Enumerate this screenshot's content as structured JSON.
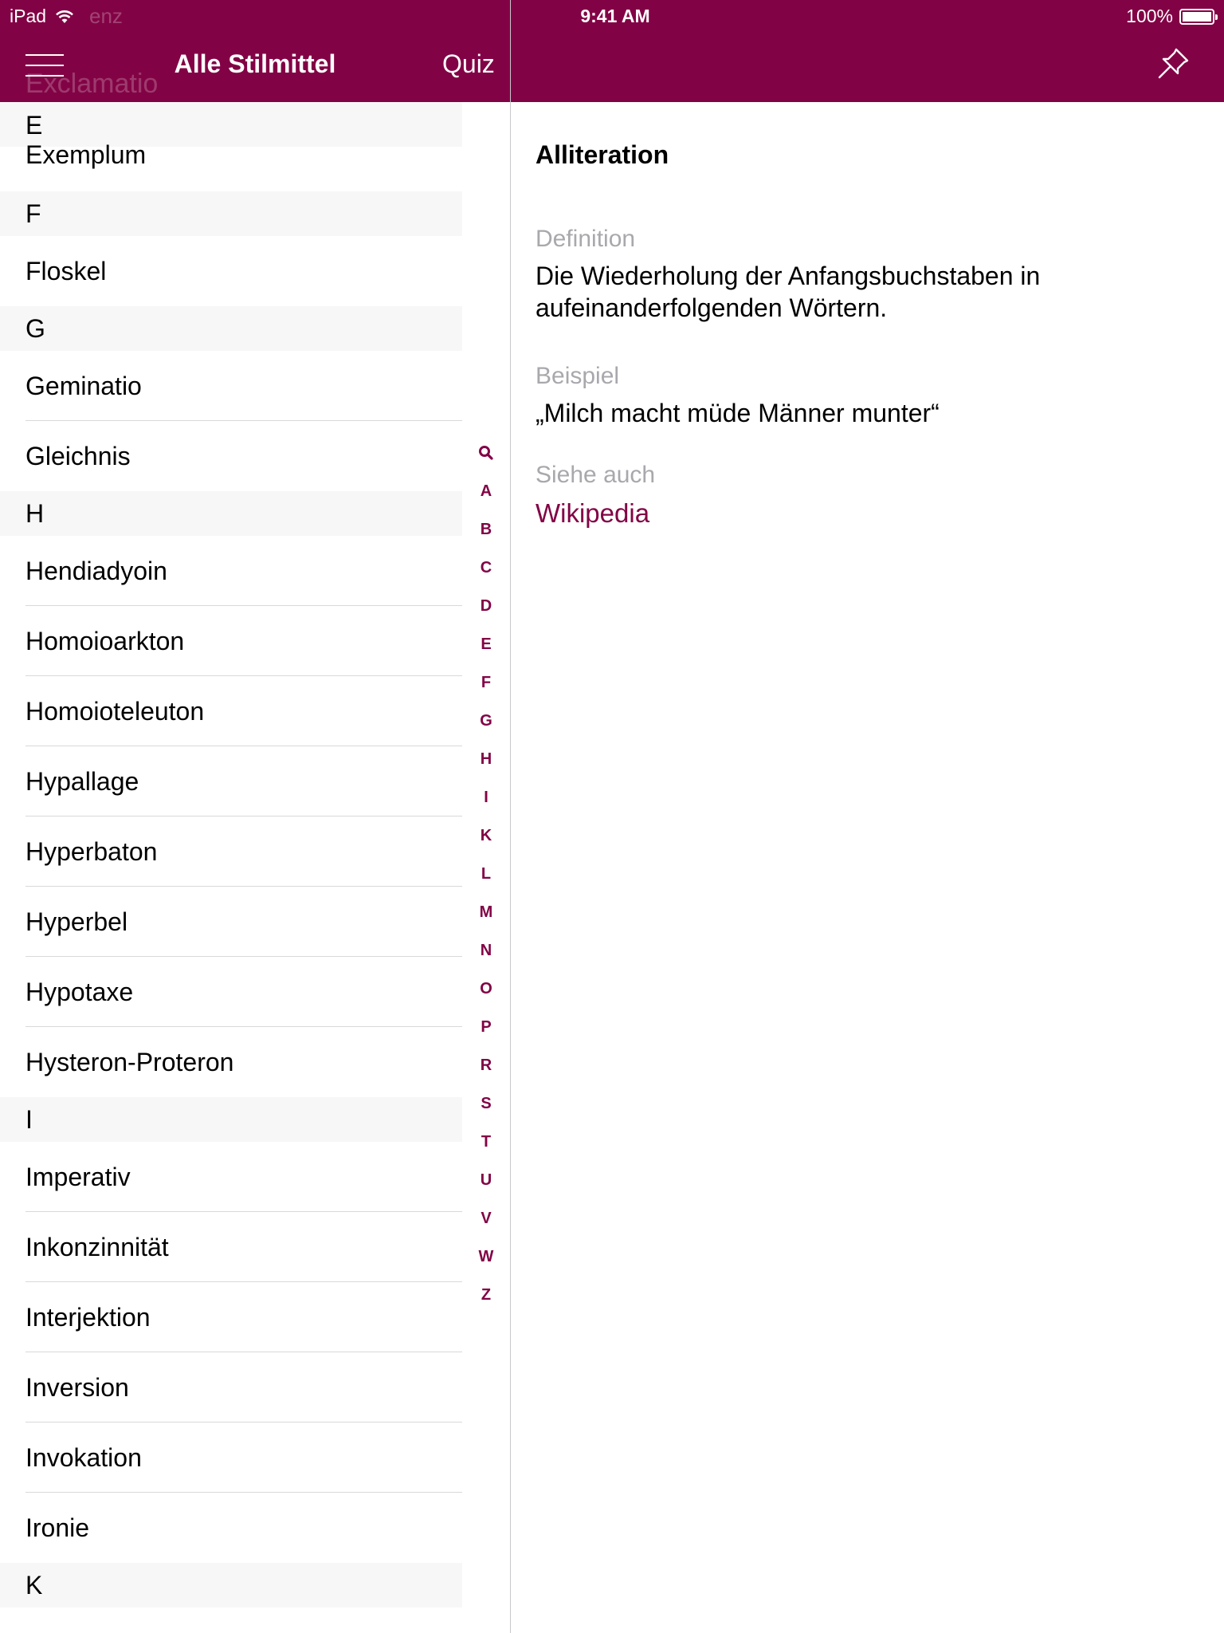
{
  "status_bar": {
    "device": "iPad",
    "ghost_text": "enz",
    "time": "9:41 AM",
    "battery_percent": "100%",
    "battery_level": 1.0
  },
  "nav": {
    "ghost_text": "Exclamatio",
    "title": "Alle Stilmittel",
    "quiz_label": "Quiz"
  },
  "list": {
    "sections": [
      {
        "letter": "E",
        "items": [
          "Exemplum"
        ]
      },
      {
        "letter": "F",
        "items": [
          "Floskel"
        ]
      },
      {
        "letter": "G",
        "items": [
          "Geminatio",
          "Gleichnis"
        ]
      },
      {
        "letter": "H",
        "items": [
          "Hendiadyoin",
          "Homoioarkton",
          "Homoioteleuton",
          "Hypallage",
          "Hyperbaton",
          "Hyperbel",
          "Hypotaxe",
          "Hysteron-Proteron"
        ]
      },
      {
        "letter": "I",
        "items": [
          "Imperativ",
          "Inkonzinnität",
          "Interjektion",
          "Inversion",
          "Invokation",
          "Ironie"
        ]
      },
      {
        "letter": "K",
        "items": []
      }
    ]
  },
  "index_bar": {
    "search_icon": "search-icon",
    "letters": [
      "A",
      "B",
      "C",
      "D",
      "E",
      "F",
      "G",
      "H",
      "I",
      "K",
      "L",
      "M",
      "N",
      "O",
      "P",
      "R",
      "S",
      "T",
      "U",
      "V",
      "W",
      "Z"
    ]
  },
  "detail": {
    "title": "Alliteration",
    "definition_label": "Definition",
    "definition_text": "Die Wiederholung der Anfangsbuchstaben in aufeinanderfolgenden Wörtern.",
    "example_label": "Beispiel",
    "example_text": "„Milch macht müde Männer munter“",
    "see_also_label": "Siehe auch",
    "see_also_link": "Wikipedia"
  },
  "colors": {
    "brand": "#820345",
    "section_bg": "#f7f7f7",
    "label_gray": "#a8a8ad"
  }
}
